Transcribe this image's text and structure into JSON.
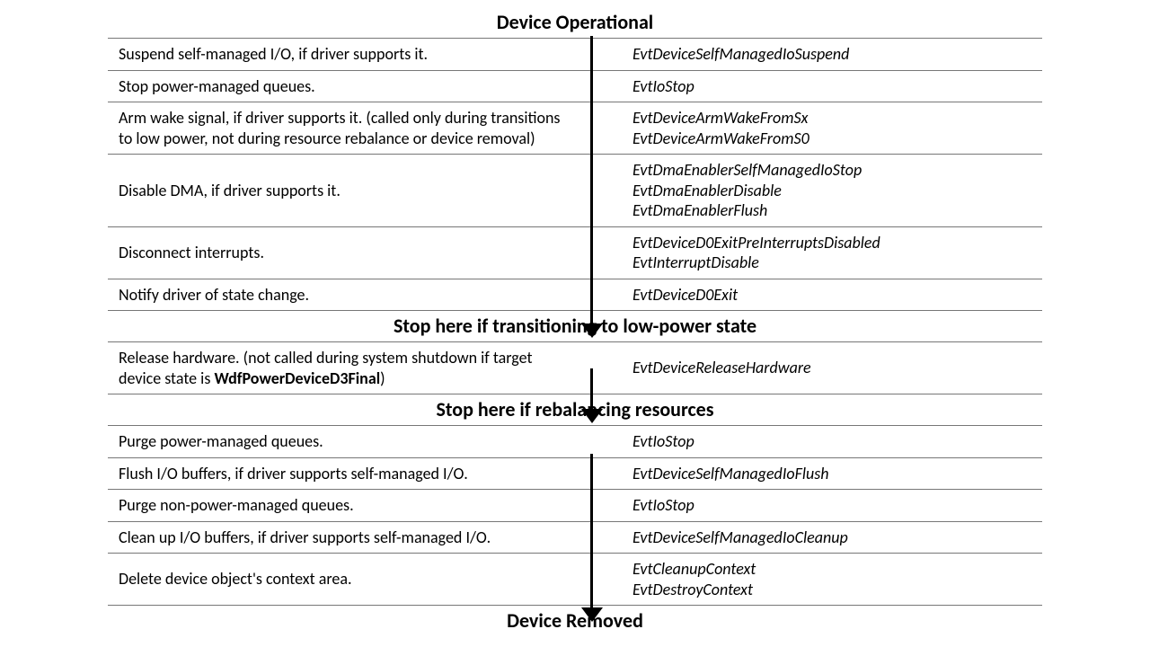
{
  "titles": {
    "top": "Device Operational",
    "mid1": "Stop here if transitioning to low-power state",
    "mid2": "Stop here if rebalancing resources",
    "bottom": "Device Removed"
  },
  "section1": [
    {
      "desc": "Suspend self-managed I/O, if driver supports it.",
      "callbacks": [
        "EvtDeviceSelfManagedIoSuspend"
      ]
    },
    {
      "desc": "Stop power-managed queues.",
      "callbacks": [
        "EvtIoStop"
      ]
    },
    {
      "desc": "Arm wake signal, if driver supports it. (called only during transitions to low power, not during resource rebalance or device removal)",
      "callbacks": [
        "EvtDeviceArmWakeFromSx",
        "EvtDeviceArmWakeFromS0"
      ]
    },
    {
      "desc": "Disable DMA, if driver supports it.",
      "callbacks": [
        "EvtDmaEnablerSelfManagedIoStop",
        "EvtDmaEnablerDisable",
        "EvtDmaEnablerFlush"
      ]
    },
    {
      "desc": "Disconnect interrupts.",
      "callbacks": [
        "EvtDeviceD0ExitPreInterruptsDisabled",
        "EvtInterruptDisable"
      ]
    },
    {
      "desc": "Notify driver of state change.",
      "callbacks": [
        "EvtDeviceD0Exit"
      ]
    }
  ],
  "section2": [
    {
      "desc_prefix": "Release hardware. (not called during system shutdown if target device state is ",
      "desc_bold": "WdfPowerDeviceD3Final",
      "desc_suffix": ")",
      "callbacks": [
        "EvtDeviceReleaseHardware"
      ]
    }
  ],
  "section3": [
    {
      "desc": "Purge power-managed queues.",
      "callbacks": [
        "EvtIoStop"
      ]
    },
    {
      "desc": "Flush I/O buffers, if driver supports self-managed I/O.",
      "callbacks": [
        "EvtDeviceSelfManagedIoFlush"
      ]
    },
    {
      "desc": "Purge non-power-managed queues.",
      "callbacks": [
        "EvtIoStop"
      ]
    },
    {
      "desc": "Clean up I/O buffers, if driver supports self-managed I/O.",
      "callbacks": [
        "EvtDeviceSelfManagedIoCleanup"
      ]
    },
    {
      "desc": "Delete device object's context area.",
      "callbacks": [
        "EvtCleanupContext",
        "EvtDestroyContext"
      ]
    }
  ]
}
